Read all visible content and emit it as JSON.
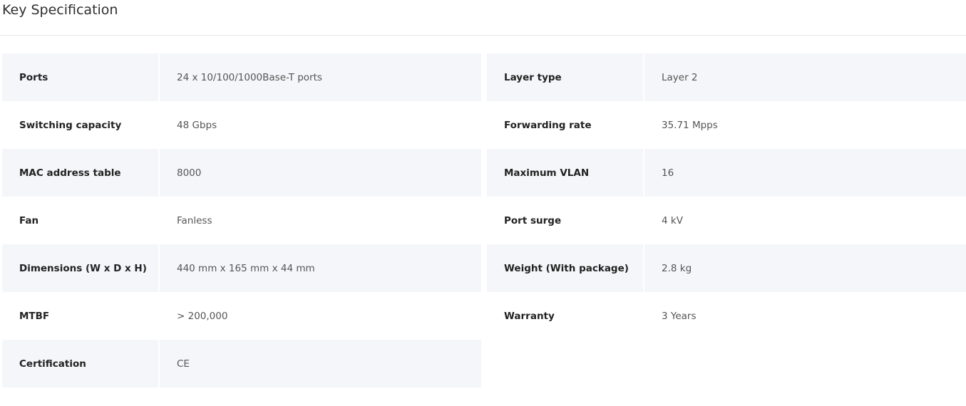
{
  "section": {
    "title": "Key Specification"
  },
  "specs": {
    "row0": {
      "left_label": "Ports",
      "left_value": "24 x 10/100/1000Base-T ports",
      "right_label": "Layer type",
      "right_value": "Layer 2"
    },
    "row1": {
      "left_label": "Switching capacity",
      "left_value": "48 Gbps",
      "right_label": "Forwarding rate",
      "right_value": "35.71 Mpps"
    },
    "row2": {
      "left_label": "MAC address table",
      "left_value": "8000",
      "right_label": "Maximum VLAN",
      "right_value": "16"
    },
    "row3": {
      "left_label": "Fan",
      "left_value": "Fanless",
      "right_label": "Port surge",
      "right_value": "4 kV"
    },
    "row4": {
      "left_label": "Dimensions (W x D x H)",
      "left_value": "440 mm x 165 mm x 44 mm",
      "right_label": "Weight (With package)",
      "right_value": "2.8 kg"
    },
    "row5": {
      "left_label": "MTBF",
      "left_value": "> 200,000",
      "right_label": "Warranty",
      "right_value": "3 Years"
    },
    "row6": {
      "left_label": "Certification",
      "left_value": "CE"
    }
  },
  "colors": {
    "shaded_row_background": "#f5f6f9",
    "divider": "#e8e9ec"
  }
}
